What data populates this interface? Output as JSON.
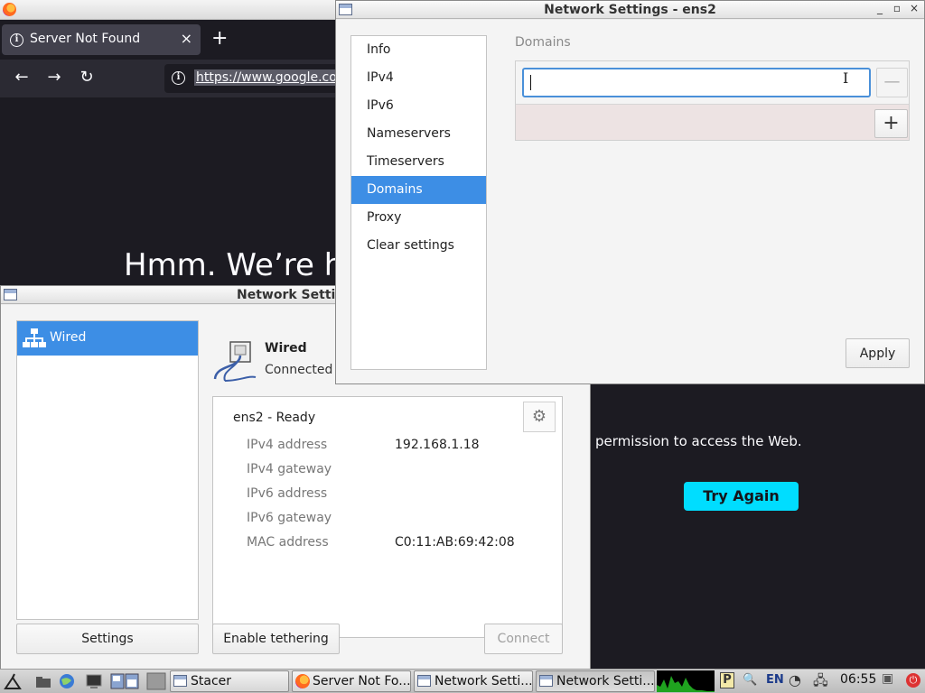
{
  "firefox": {
    "tab_title": "Server Not Found",
    "tab_close": "×",
    "new_tab": "+",
    "url": "https://www.google.co",
    "heading": "Hmm. We’re h",
    "permission_text": "permission to access the Web.",
    "try_again": "Try Again",
    "accent": "#00ddff"
  },
  "main_window": {
    "title": "Network Setti",
    "connections": [
      {
        "label": "Wired",
        "icon": "network-wired-icon"
      }
    ],
    "detail": {
      "title": "Wired",
      "status": "Connected",
      "interface": "ens2 - Ready",
      "properties": [
        {
          "label": "IPv4 address",
          "value": "192.168.1.18"
        },
        {
          "label": "IPv4 gateway",
          "value": ""
        },
        {
          "label": "IPv6 address",
          "value": ""
        },
        {
          "label": "IPv6 gateway",
          "value": ""
        },
        {
          "label": "MAC address",
          "value": "C0:11:AB:69:42:08"
        }
      ]
    },
    "buttons": {
      "settings": "Settings",
      "tethering": "Enable tethering",
      "connect": "Connect"
    }
  },
  "dialog": {
    "title": "Network Settings - ens2",
    "controls": {
      "minimize": "_",
      "maximize": "▫",
      "close": "×"
    },
    "nav": [
      "Info",
      "IPv4",
      "IPv6",
      "Nameservers",
      "Timeservers",
      "Domains",
      "Proxy",
      "Clear settings"
    ],
    "active_nav": "Domains",
    "domains_label": "Domains",
    "domain_value": "",
    "remove_label": "—",
    "add_label": "+",
    "apply": "Apply",
    "accent": "#3d8ee5"
  },
  "taskbar": {
    "tasks": [
      {
        "label": "Stacer",
        "icon": "window-icon"
      },
      {
        "label": "Server Not Fo...",
        "icon": "firefox-icon"
      },
      {
        "label": "Network Setti...",
        "icon": "window-icon"
      },
      {
        "label": "Network Setti...",
        "icon": "window-icon"
      }
    ],
    "tray": {
      "keyboard": "EN"
    },
    "clock": "06:55"
  }
}
